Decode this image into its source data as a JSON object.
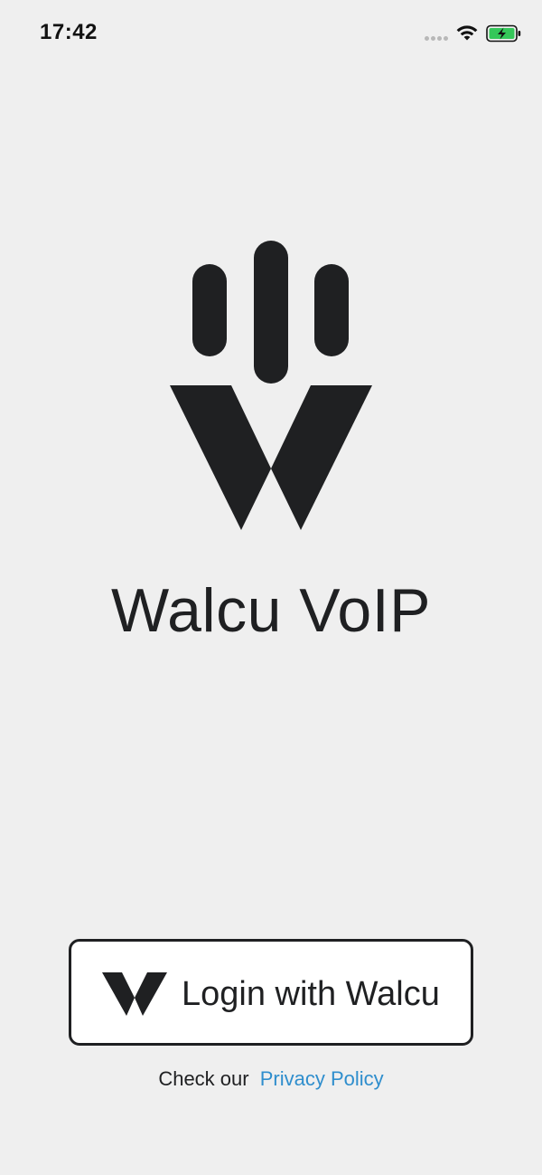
{
  "status_bar": {
    "time": "17:42"
  },
  "app": {
    "title": "Walcu VoIP"
  },
  "login": {
    "label": "Login with Walcu"
  },
  "privacy": {
    "prefix": "Check our",
    "link_label": "Privacy Policy"
  },
  "colors": {
    "background": "#efefef",
    "logo": "#1f2022",
    "link": "#2f8ecd",
    "battery_fill": "#34c759"
  },
  "icons": {
    "signal": "signal-dots-icon",
    "wifi": "wifi-icon",
    "battery": "battery-charging-icon",
    "logo": "walcu-logo-icon"
  }
}
